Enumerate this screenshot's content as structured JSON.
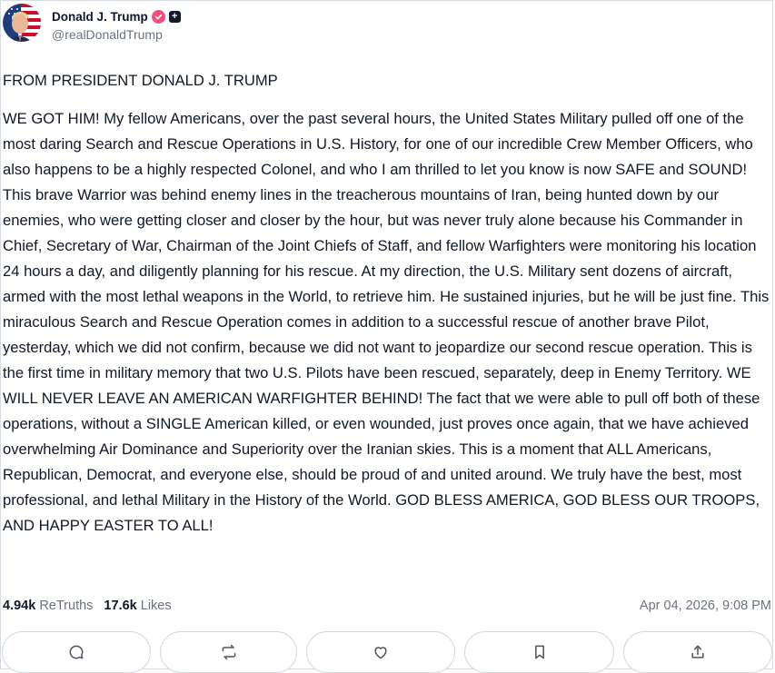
{
  "author": {
    "display_name": "Donald J. Trump",
    "handle": "@realDonaldTrump",
    "verified_icon": "verified-check-icon",
    "plus_icon": "plus-badge-icon",
    "plus_glyph": "+"
  },
  "post": {
    "heading": "FROM PRESIDENT DONALD J. TRUMP",
    "body": "WE GOT HIM! My fellow Americans, over the past several hours, the United States Military pulled off one of the most daring Search and Rescue Operations in U.S. History, for one of our incredible Crew Member Officers, who also happens to be a highly respected Colonel, and who I am thrilled to let you know is now SAFE and SOUND! This brave Warrior was behind enemy lines in the treacherous mountains of Iran, being hunted down by our enemies, who were getting closer and closer by the hour, but was never truly alone because his Commander in Chief, Secretary of War, Chairman of the Joint Chiefs of Staff, and fellow Warfighters were monitoring his location 24 hours a day, and diligently planning for his rescue. At my direction, the U.S. Military sent dozens of aircraft, armed with the most lethal weapons in the World, to retrieve him. He sustained injuries, but he will be just fine. This miraculous Search and Rescue Operation comes in addition to a successful rescue of another brave Pilot, yesterday, which we did not confirm, because we did not want to jeopardize our second rescue operation. This is the first time in military memory that two U.S. Pilots have been rescued, separately, deep in Enemy Territory. WE WILL NEVER LEAVE AN AMERICAN WARFIGHTER BEHIND! The fact that we were able to pull off both of these operations, without a SINGLE American killed, or even wounded, just proves once again, that we have achieved overwhelming Air Dominance and Superiority over the Iranian skies. This is a moment that ALL Americans, Republican, Democrat, and everyone else, should be proud of and united around. We truly have the best, most professional, and lethal Military in the History of the World. GOD BLESS AMERICA, GOD BLESS OUR TROOPS, AND HAPPY EASTER TO ALL!"
  },
  "stats": {
    "retruths_count": "4.94k",
    "retruths_label": "ReTruths",
    "likes_count": "17.6k",
    "likes_label": "Likes"
  },
  "timestamp": "Apr 04, 2026, 9:08 PM",
  "actions": [
    {
      "icon": "reply-icon"
    },
    {
      "icon": "retruth-icon"
    },
    {
      "icon": "like-icon"
    },
    {
      "icon": "bookmark-icon"
    },
    {
      "icon": "share-icon"
    }
  ],
  "colors": {
    "verified": "#f24e7f",
    "text": "#111827",
    "muted": "#6b7280",
    "border": "#d4d9e0"
  }
}
